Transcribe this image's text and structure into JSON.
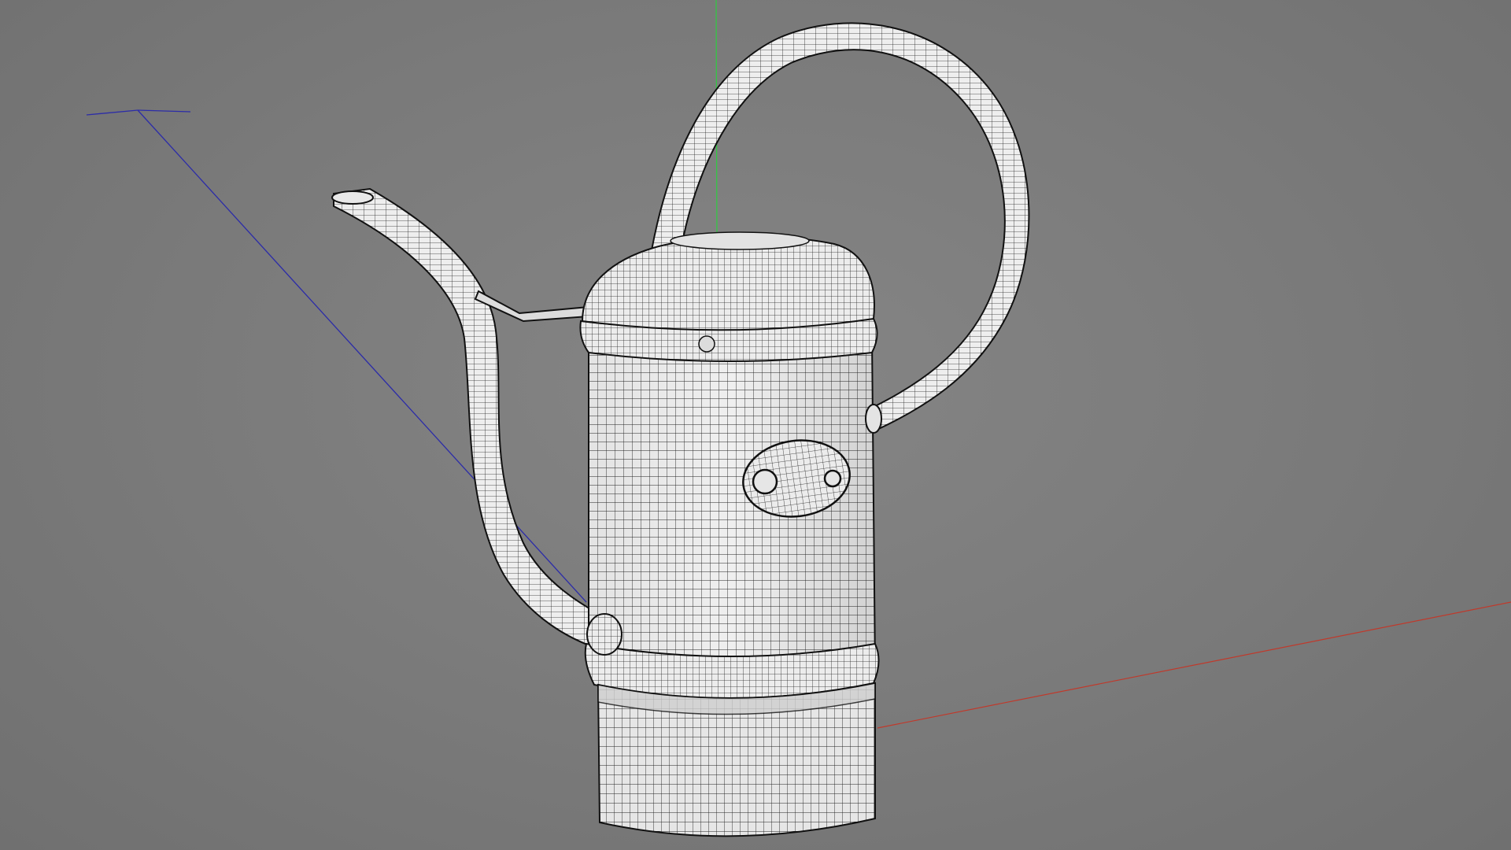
{
  "viewport": {
    "background_color": "#7b7b7b",
    "mesh_fill_color": "#efefef",
    "mesh_wire_color": "#1a1a1a",
    "axes": {
      "x_color": "#c0392b",
      "y_color": "#2ecc40",
      "z_color": "#2c2ca8"
    },
    "object": "watering-can"
  }
}
